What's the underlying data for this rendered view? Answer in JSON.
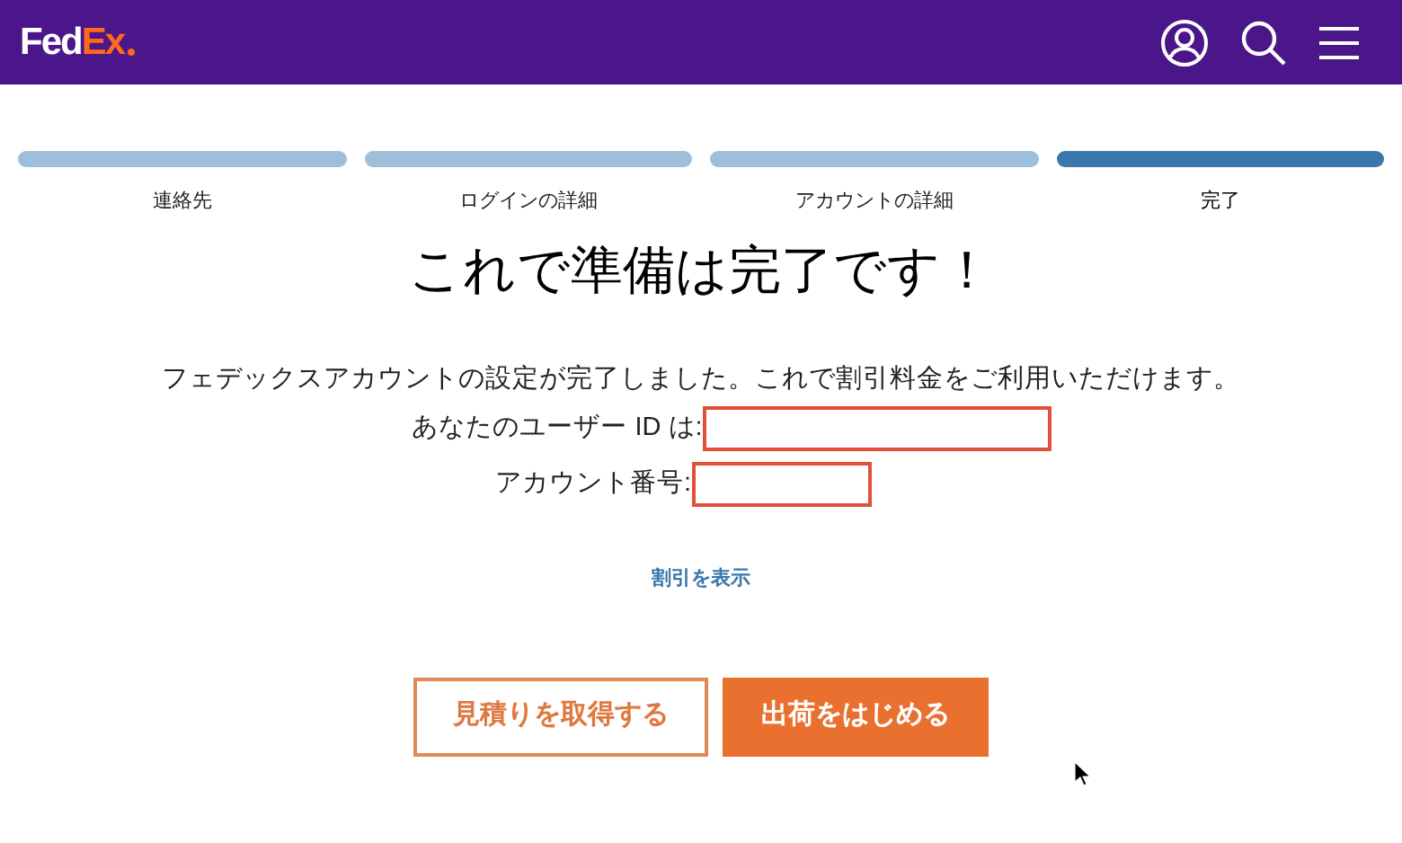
{
  "header": {
    "logo": {
      "part_1": "Fed",
      "part_2": "Ex"
    }
  },
  "steps": [
    {
      "label": "連絡先",
      "selected": false
    },
    {
      "label": "ログインの詳細",
      "selected": false
    },
    {
      "label": "アカウントの詳細",
      "selected": false
    },
    {
      "label": "完了",
      "selected": true
    }
  ],
  "title": "これで準備は完了です！",
  "message": "フェデックスアカウントの設定が完了しました。これで割引料金をご利用いただけます。",
  "fields": [
    {
      "label": "あなたのユーザー ID は:",
      "highlighted": true,
      "kind": "wide"
    },
    {
      "label": "アカウント番号:",
      "highlighted": true,
      "kind": "narrow"
    }
  ],
  "link": "割引を表示",
  "buttons": [
    {
      "label": "見積りを取得する",
      "kind": "outline"
    },
    {
      "label": "出荷をはじめる",
      "kind": "filled"
    }
  ]
}
